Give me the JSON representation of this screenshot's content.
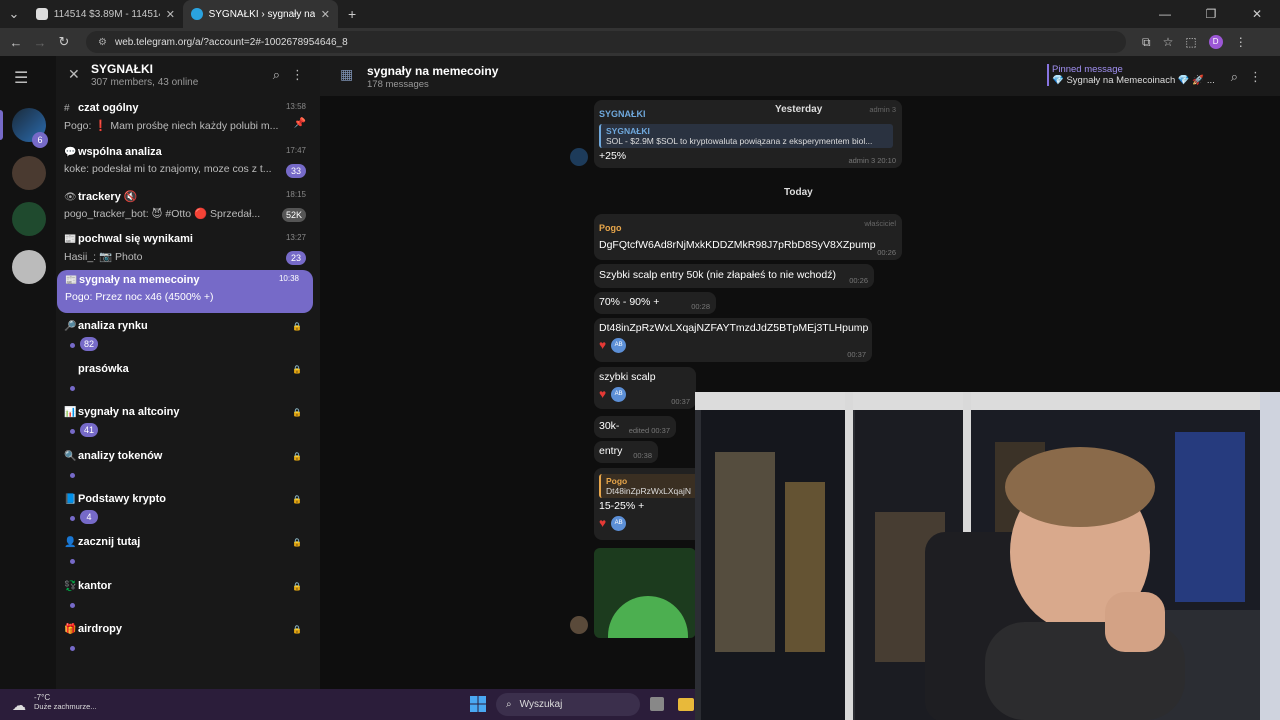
{
  "browser": {
    "tabs": [
      {
        "label": "114514 $3.89M - 114514 / SOL",
        "active": false
      },
      {
        "label": "SYGNAŁKI › sygnały na memeco",
        "active": true
      }
    ],
    "url": "web.telegram.org/a/?account=2#-1002678954646_8",
    "profile_initial": "D"
  },
  "sidebar": {
    "title": "SYGNAŁKI",
    "subtitle": "307 members, 43 online",
    "rail_badge": "6",
    "topics": [
      {
        "icon": "#",
        "name": "czat ogólny",
        "msg": "Pogo: ❗ Mam prośbę niech każdy polubi m...",
        "time": "13:58",
        "badge": "",
        "pinned": true
      },
      {
        "icon": "💬",
        "name": "wspólna analiza",
        "msg": "koke: podesłał mi to znajomy, moze cos z t...",
        "time": "17:47",
        "badge": "33"
      },
      {
        "icon": "👁",
        "name": "trackery 🔇",
        "msg": "pogo_tracker_bot: 😈 #Otto 🔴 Sprzedał...",
        "time": "18:15",
        "badge": "52K",
        "gray": true
      },
      {
        "icon": "📰",
        "name": "pochwal się wynikami",
        "msg": "Hasii_: 📷 Photo",
        "time": "13:27",
        "badge": "23"
      },
      {
        "icon": "📰",
        "name": "sygnały na memecoiny",
        "msg": "Pogo: Przez noc x46 (4500% +)",
        "time": "10:38",
        "badge": "",
        "active": true
      },
      {
        "icon": "🔎",
        "name": "analiza rynku",
        "msg": "",
        "time": "",
        "count": "82"
      },
      {
        "icon": "",
        "name": "prasówka",
        "msg": "",
        "time": ""
      },
      {
        "icon": "📊",
        "name": "sygnały na altcoiny",
        "msg": "",
        "time": "",
        "count": "41"
      },
      {
        "icon": "🔍",
        "name": "analizy tokenów",
        "msg": "",
        "time": ""
      },
      {
        "icon": "📘",
        "name": "Podstawy krypto",
        "msg": "",
        "time": "",
        "count": "4"
      },
      {
        "icon": "👤",
        "name": "zacznij tutaj",
        "msg": "",
        "time": ""
      },
      {
        "icon": "💱",
        "name": "kantor",
        "msg": "",
        "time": ""
      },
      {
        "icon": "🎁",
        "name": "airdropy",
        "msg": "",
        "time": ""
      }
    ]
  },
  "chat": {
    "title": "sygnały na memecoiny",
    "subtitle": "178 messages",
    "pinned_label": "Pinned message",
    "pinned_text": "💎 Sygnały na Memecoinach 💎 🚀 ...",
    "date_yesterday": "Yesterday",
    "date_today": "Today",
    "m1": {
      "sender": "SYGNAŁKI",
      "role": "admin 3",
      "reply_title": "SYGNAŁKI",
      "reply_text": "SOL - $2.9M $SOL to kryptowaluta powiązana z eksperymentem biol...",
      "text": "+25%",
      "time": "admin 3 20:10"
    },
    "m2": {
      "sender": "Pogo",
      "role": "właściciel",
      "text": "DgFQtcfW6Ad8rNjMxkKDDZMkR98J7pRbD8SyV8XZpump",
      "time": "00:26"
    },
    "m3": {
      "text": "Szybki scalp entry  50k (nie złapałeś to nie wchodź)",
      "time": "00:26"
    },
    "m4": {
      "text": "70% - 90% +",
      "time": "00:28"
    },
    "m5": {
      "text": "Dt48inZpRzWxLXqajNZFAYTmzdJdZ5BTpMEj3TLHpump",
      "time": "00:37"
    },
    "m6": {
      "text": "szybki scalp",
      "time": "00:37"
    },
    "m7": {
      "text": "30k-",
      "time": "edited 00:37"
    },
    "m8": {
      "text": "entry",
      "time": "00:38"
    },
    "m9": {
      "reply_title": "Pogo",
      "reply_text": "Dt48inZpRzWxLXqajN",
      "text": "15-25% +"
    },
    "react_initials": "AB"
  },
  "taskbar": {
    "temp": "-7°C",
    "weather": "Duże zachmurze...",
    "search": "Wyszukaj"
  }
}
